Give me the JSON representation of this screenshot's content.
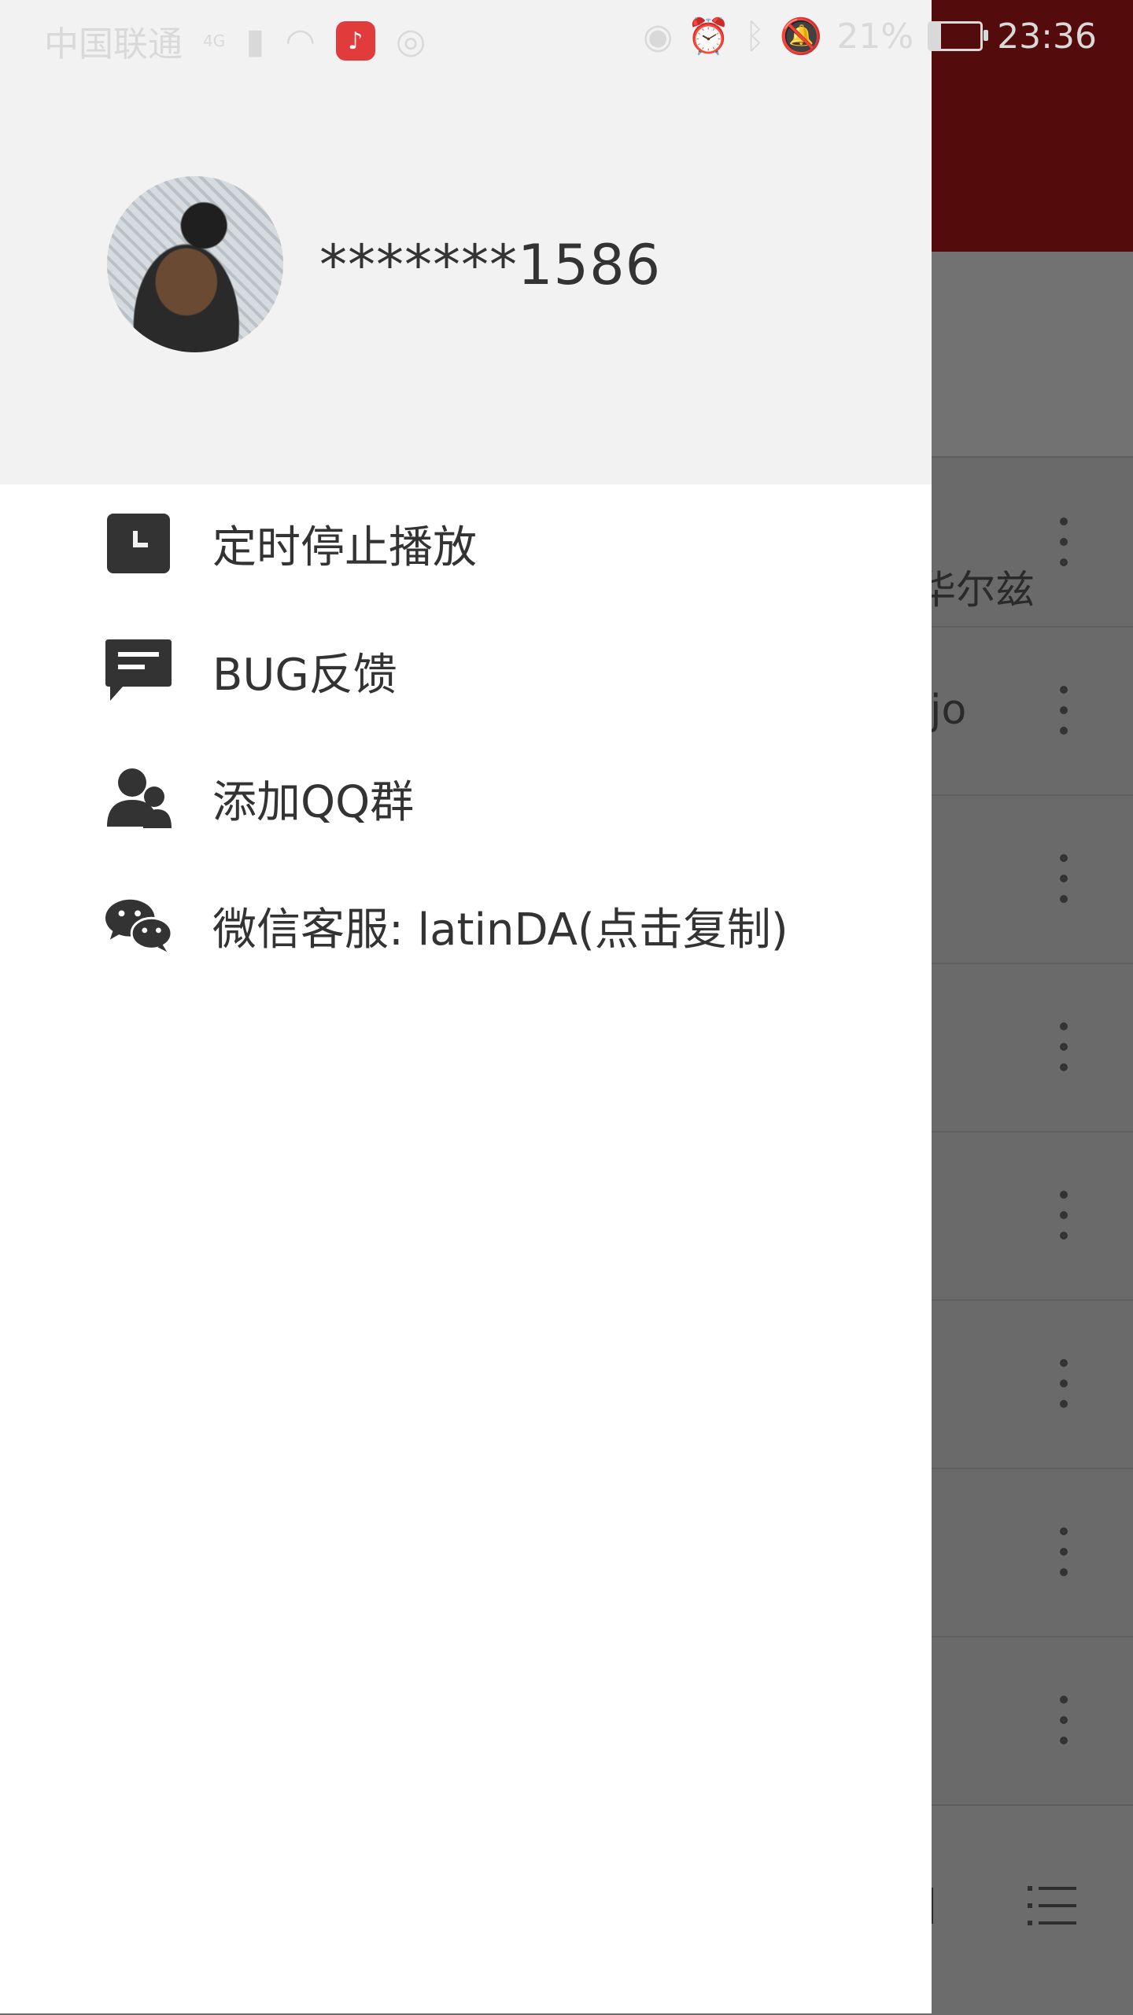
{
  "status_bar": {
    "carrier": "中国联通",
    "network_badge": "4G",
    "battery_percent": "21%",
    "time": "23:36",
    "battery_level": 0.21
  },
  "drawer": {
    "username": "*******1586",
    "menu": [
      {
        "label": "定时停止播放",
        "icon": "timer-icon"
      },
      {
        "label": "BUG反馈",
        "icon": "feedback-icon"
      },
      {
        "label": "添加QQ群",
        "icon": "group-icon"
      },
      {
        "label": "微信客服: latinDA(点击复制)",
        "icon": "wechat-icon"
      }
    ]
  },
  "background": {
    "header_text": "华尔兹",
    "item_text": "jo"
  },
  "colors": {
    "accent": "#530b0b",
    "drawer_header_bg": "#f2f2f2",
    "text": "#333333",
    "scrim": "#6a6a6a"
  }
}
